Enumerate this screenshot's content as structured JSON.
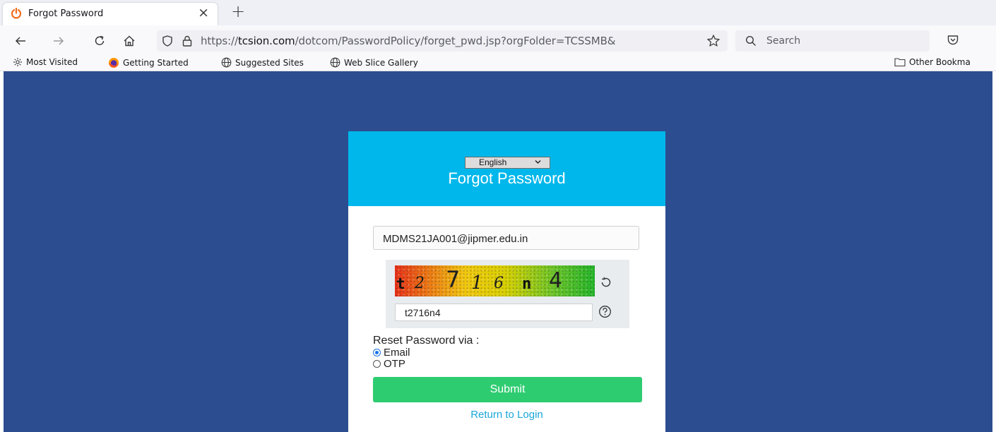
{
  "browser": {
    "tab": {
      "title": "Forgot Password",
      "close": "×"
    },
    "new_tab": "+",
    "url": {
      "host": "tcsion.com",
      "scheme": "https://",
      "path": "/dotcom/PasswordPolicy/forget_pwd.jsp?orgFolder=TCSSMB&"
    },
    "search": {
      "placeholder": "Search"
    },
    "bookmarks": [
      {
        "label": "Most Visited",
        "icon": "gear-icon"
      },
      {
        "label": "Getting Started",
        "icon": "firefox-icon"
      },
      {
        "label": "Suggested Sites",
        "icon": "globe-icon"
      },
      {
        "label": "Web Slice Gallery",
        "icon": "globe-icon"
      }
    ],
    "other_bookmarks": "Other Bookma"
  },
  "page": {
    "background_color": "#2c4d8f",
    "header_color": "#00b7eb",
    "language": "English",
    "title": "Forgot Password",
    "email_value": "MDMS21JA001@jipmer.edu.in",
    "captcha_text": "t2716n4",
    "captcha_input_value": "t2716n4",
    "reset_label": "Reset Password via :",
    "options": [
      {
        "label": "Email",
        "checked": true
      },
      {
        "label": "OTP",
        "checked": false
      }
    ],
    "submit_label": "Submit",
    "return_link": "Return to Login",
    "submit_color": "#2ecc71"
  }
}
